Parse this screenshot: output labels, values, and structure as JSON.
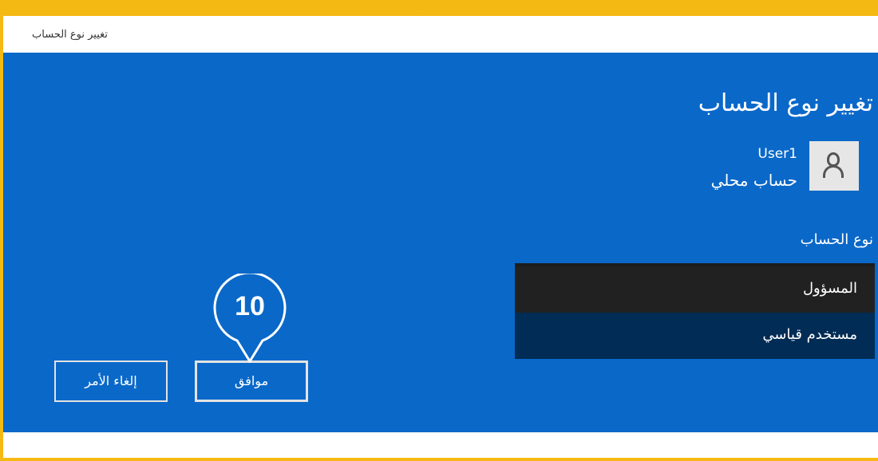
{
  "window": {
    "title": "تغيير نوع الحساب"
  },
  "page": {
    "heading": "تغيير نوع الحساب"
  },
  "user": {
    "name": "User1",
    "account_type": "حساب محلي",
    "avatar_icon": "user-icon"
  },
  "account_type_section": {
    "label": "نوع الحساب",
    "options": [
      {
        "label": "المسؤول",
        "selected": false
      },
      {
        "label": "مستخدم قياسي",
        "selected": true
      }
    ]
  },
  "buttons": {
    "ok_label": "موافق",
    "cancel_label": "إلغاء الأمر"
  },
  "callout": {
    "number": "10"
  },
  "colors": {
    "window_background": "#0a68c9",
    "frame_highlight": "#f4b912",
    "listbox_background": "#1d1d1d",
    "selected_option": "#002c55",
    "callout_fill": "#0a68c9"
  }
}
